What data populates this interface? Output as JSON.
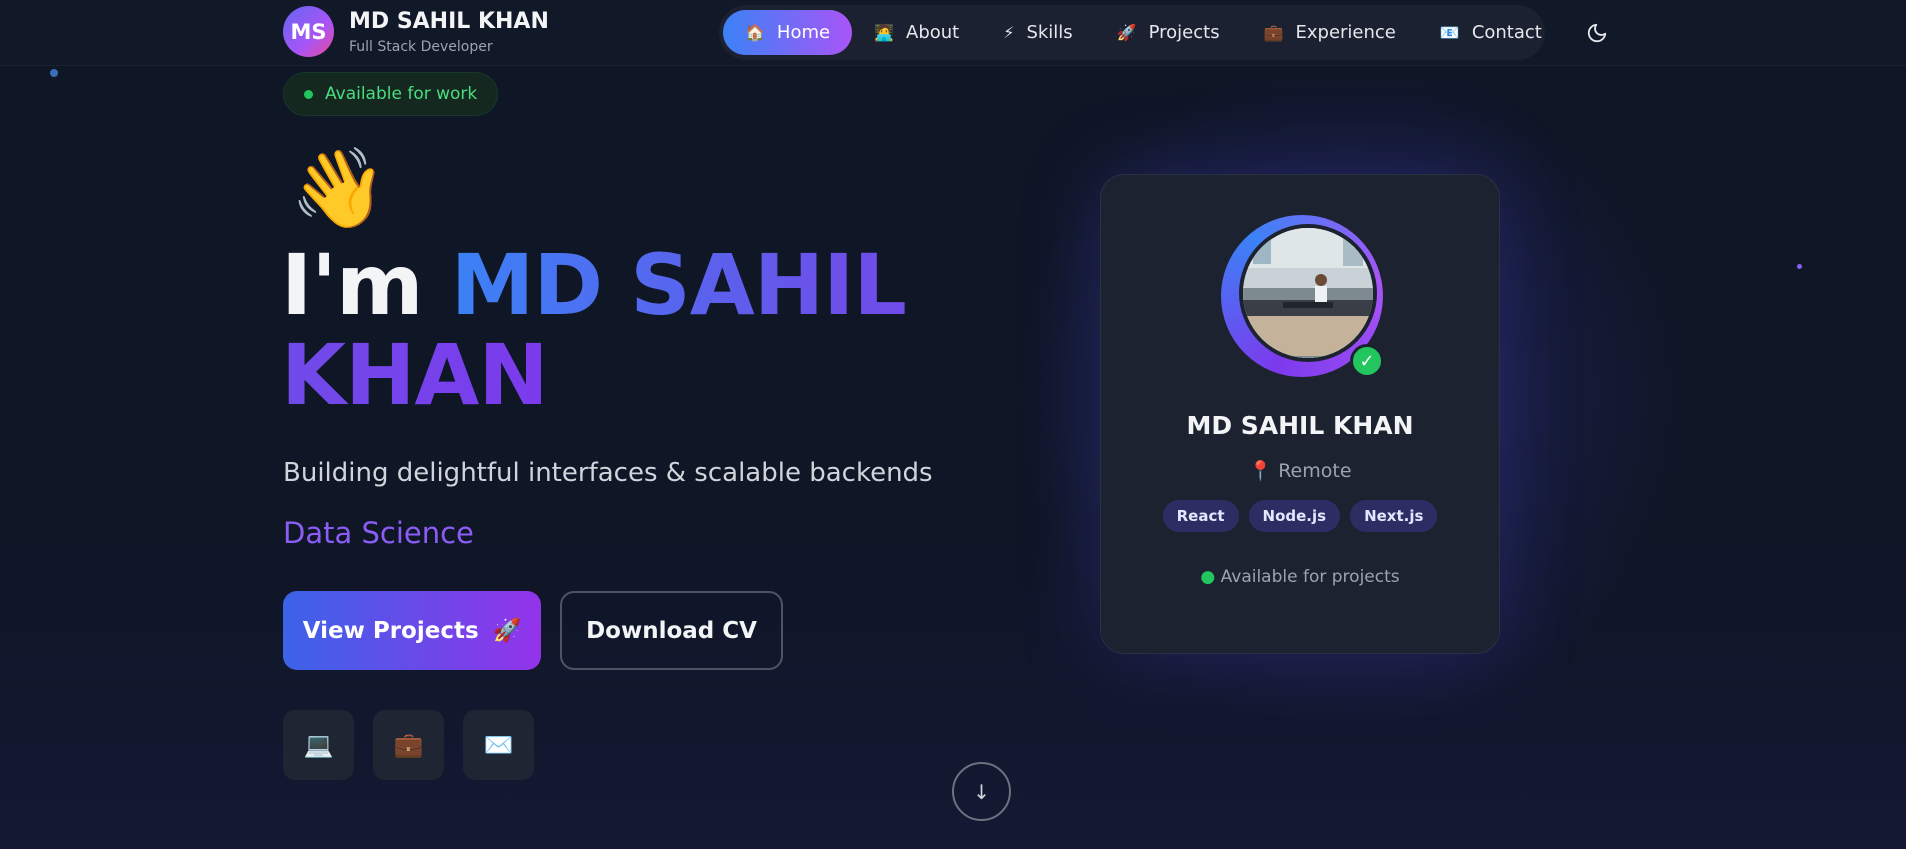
{
  "navbar": {
    "logo_initials": "MS",
    "brand_name": "MD SAHIL KHAN",
    "brand_role": "Full Stack Developer",
    "items": [
      {
        "label": "Home",
        "icon": "🏠",
        "icon_name": "home-icon",
        "active": true
      },
      {
        "label": "About",
        "icon": "🧑‍💻",
        "icon_name": "person-icon",
        "active": false
      },
      {
        "label": "Skills",
        "icon": "⚡",
        "icon_name": "lightning-icon",
        "active": false
      },
      {
        "label": "Projects",
        "icon": "🚀",
        "icon_name": "rocket-icon",
        "active": false
      },
      {
        "label": "Experience",
        "icon": "💼",
        "icon_name": "briefcase-icon",
        "active": false
      },
      {
        "label": "Contact",
        "icon": "📧",
        "icon_name": "contact-icon",
        "active": false
      }
    ],
    "theme_toggle_icon": "moon-icon"
  },
  "hero": {
    "availability": "Available for work",
    "wave_emoji": "👋",
    "title_prefix": "I'm ",
    "title_name": "MD SAHIL KHAN",
    "subtitle": "Building delightful interfaces & scalable backends",
    "role": "Data Science",
    "primary_button": "View Projects",
    "primary_button_emoji": "🚀",
    "secondary_button": "Download CV",
    "socials": [
      {
        "icon": "💻",
        "name": "laptop-icon"
      },
      {
        "icon": "💼",
        "name": "briefcase-icon"
      },
      {
        "icon": "✉️",
        "name": "mail-icon"
      }
    ],
    "scroll_icon": "↓"
  },
  "profile_card": {
    "name": "MD SAHIL KHAN",
    "location_icon": "📍",
    "location": "Remote",
    "tags": [
      "React",
      "Node.js",
      "Next.js"
    ],
    "status_dot": "●",
    "status": "Available for projects",
    "verified_icon": "✓"
  },
  "colors": {
    "background": "#0f1626",
    "accent_blue": "#3b82f6",
    "accent_purple": "#8b5cf6",
    "status_green": "#22c55e"
  }
}
